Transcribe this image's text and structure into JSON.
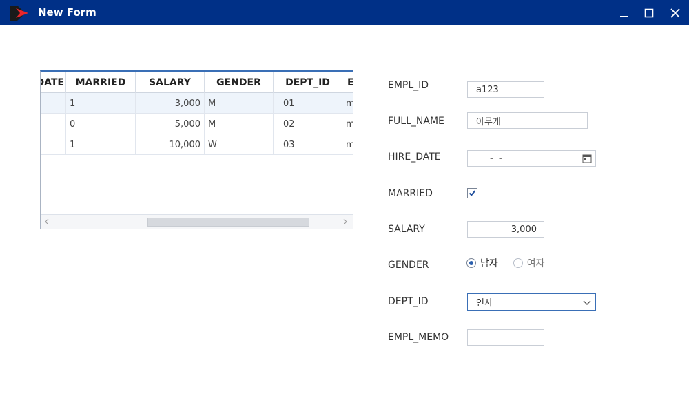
{
  "window": {
    "title": "New Form"
  },
  "grid": {
    "columns": [
      "DATE",
      "MARRIED",
      "SALARY",
      "GENDER",
      "DEPT_ID",
      "E"
    ],
    "rows": [
      [
        "",
        "1",
        "3,000",
        "M",
        "01",
        "m"
      ],
      [
        "",
        "0",
        "5,000",
        "M",
        "02",
        "m"
      ],
      [
        "",
        "1",
        "10,000",
        "W",
        "03",
        "m"
      ]
    ]
  },
  "form": {
    "empl_id": {
      "label": "EMPL_ID",
      "value": "a123"
    },
    "full_name": {
      "label": "FULL_NAME",
      "value": "아무개"
    },
    "hire_date": {
      "label": "HIRE_DATE",
      "value": "- -"
    },
    "married": {
      "label": "MARRIED",
      "checked": true
    },
    "salary": {
      "label": "SALARY",
      "value": "3,000"
    },
    "gender": {
      "label": "GENDER",
      "options": [
        "남자",
        "여자"
      ],
      "selected": "남자"
    },
    "dept_id": {
      "label": "DEPT_ID",
      "value": "인사"
    },
    "empl_memo": {
      "label": "EMPL_MEMO",
      "value": ""
    }
  },
  "colors": {
    "titlebar": "#003087",
    "accent": "#3a6fb6",
    "logo_red": "#e8262b"
  },
  "icons": [
    "app-logo-icon",
    "minimize-icon",
    "maximize-icon",
    "close-icon",
    "calendar-icon",
    "check-icon",
    "chevron-down-icon",
    "scroll-left-icon",
    "scroll-right-icon"
  ]
}
